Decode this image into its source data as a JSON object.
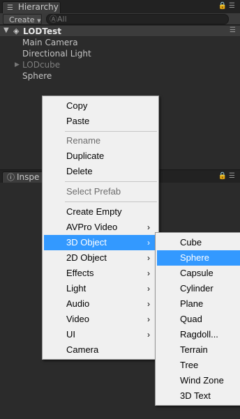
{
  "hierarchy": {
    "tab_label": "Hierarchy",
    "tab_icon": "list-icon",
    "create_label": "Create",
    "search_placeholder": "ⒶAll",
    "scene": {
      "name": "LODTest",
      "menu_icon": "menu-icon"
    },
    "items": [
      {
        "label": "Main Camera",
        "dim": false
      },
      {
        "label": "Directional Light",
        "dim": false
      },
      {
        "label": "LODcube",
        "dim": true
      },
      {
        "label": "Sphere",
        "dim": false
      }
    ]
  },
  "inspector": {
    "tab_label": "Inspe",
    "tab_icon": "info-icon"
  },
  "context_menu": {
    "items": [
      {
        "label": "Copy"
      },
      {
        "label": "Paste"
      },
      {
        "label": "Rename",
        "disabled": true
      },
      {
        "label": "Duplicate"
      },
      {
        "label": "Delete"
      },
      {
        "label": "Select Prefab",
        "disabled": true
      },
      {
        "label": "Create Empty"
      },
      {
        "label": "AVPro Video",
        "submenu": true
      },
      {
        "label": "3D Object",
        "submenu": true,
        "active": true
      },
      {
        "label": "2D Object",
        "submenu": true
      },
      {
        "label": "Effects",
        "submenu": true
      },
      {
        "label": "Light",
        "submenu": true
      },
      {
        "label": "Audio",
        "submenu": true
      },
      {
        "label": "Video",
        "submenu": true
      },
      {
        "label": "UI",
        "submenu": true
      },
      {
        "label": "Camera"
      }
    ],
    "submenu_arrow": "›"
  },
  "submenu_3d": {
    "items": [
      {
        "label": "Cube"
      },
      {
        "label": "Sphere",
        "active": true
      },
      {
        "label": "Capsule"
      },
      {
        "label": "Cylinder"
      },
      {
        "label": "Plane"
      },
      {
        "label": "Quad"
      },
      {
        "label": "Ragdoll..."
      },
      {
        "label": "Terrain"
      },
      {
        "label": "Tree"
      },
      {
        "label": "Wind Zone"
      },
      {
        "label": "3D Text"
      }
    ]
  },
  "colors": {
    "panel_bg": "#2b2b2b",
    "menu_bg": "#f0f0f0",
    "highlight": "#3399ff"
  }
}
